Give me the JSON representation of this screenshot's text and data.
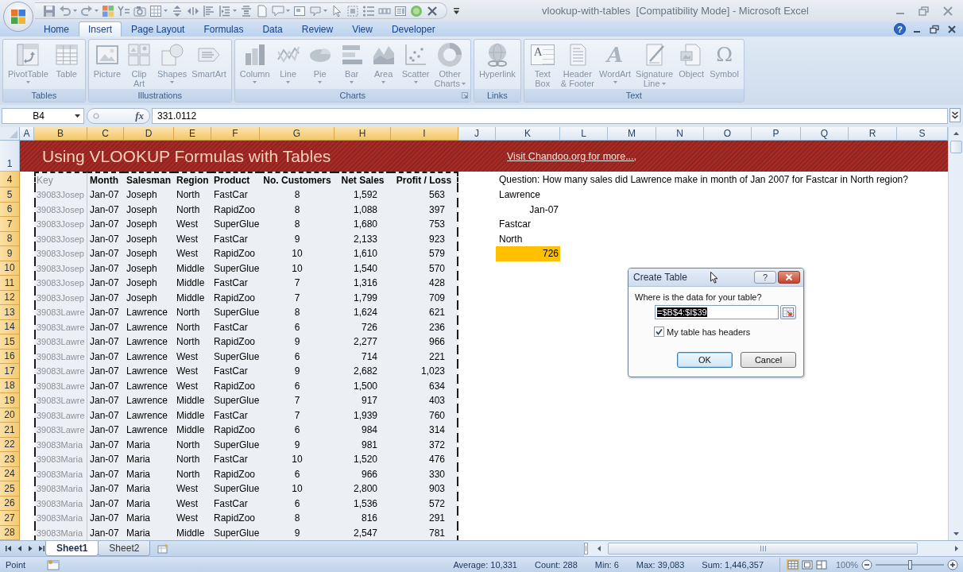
{
  "window": {
    "title": "vlookup-with-tables  [Compatibility Mode] - Microsoft Excel"
  },
  "ribbon_tabs": [
    {
      "label": "Home",
      "selected": false
    },
    {
      "label": "Insert",
      "selected": true
    },
    {
      "label": "Page Layout",
      "selected": false
    },
    {
      "label": "Formulas",
      "selected": false
    },
    {
      "label": "Data",
      "selected": false
    },
    {
      "label": "Review",
      "selected": false
    },
    {
      "label": "View",
      "selected": false
    },
    {
      "label": "Developer",
      "selected": false
    }
  ],
  "help_button": "?",
  "ribbon_groups": [
    {
      "label": "Tables",
      "launcher": false,
      "buttons": [
        {
          "label": "PivotTable",
          "dropdown": true,
          "disabled": true
        },
        {
          "label": "Table",
          "dropdown": false,
          "disabled": true
        }
      ]
    },
    {
      "label": "Illustrations",
      "launcher": false,
      "buttons": [
        {
          "label": "Picture",
          "dropdown": false,
          "disabled": true
        },
        {
          "label": "Clip\nArt",
          "dropdown": false,
          "disabled": true
        },
        {
          "label": "Shapes",
          "dropdown": true,
          "disabled": true
        },
        {
          "label": "SmartArt",
          "dropdown": false,
          "disabled": true
        }
      ]
    },
    {
      "label": "Charts",
      "launcher": true,
      "buttons": [
        {
          "label": "Column",
          "dropdown": true,
          "disabled": true
        },
        {
          "label": "Line",
          "dropdown": true,
          "disabled": true
        },
        {
          "label": "Pie",
          "dropdown": true,
          "disabled": true
        },
        {
          "label": "Bar",
          "dropdown": true,
          "disabled": true
        },
        {
          "label": "Area",
          "dropdown": true,
          "disabled": true
        },
        {
          "label": "Scatter",
          "dropdown": true,
          "disabled": true
        },
        {
          "label": "Other\nCharts",
          "dropdown": true,
          "disabled": true
        }
      ]
    },
    {
      "label": "Links",
      "launcher": false,
      "buttons": [
        {
          "label": "Hyperlink",
          "dropdown": false,
          "disabled": true
        }
      ]
    },
    {
      "label": "Text",
      "launcher": false,
      "buttons": [
        {
          "label": "Text\nBox",
          "glyph": "A",
          "dropdown": false,
          "disabled": true
        },
        {
          "label": "Header\n& Footer",
          "dropdown": false,
          "disabled": true
        },
        {
          "label": "WordArt",
          "glyph": "A",
          "dropdown": true,
          "disabled": true
        },
        {
          "label": "Signature\nLine",
          "dropdown": true,
          "disabled": true
        },
        {
          "label": "Object",
          "dropdown": false,
          "disabled": true
        },
        {
          "label": "Symbol",
          "glyph": "Ω",
          "dropdown": false,
          "disabled": true
        }
      ]
    }
  ],
  "formula_bar": {
    "name_box": "B4",
    "fx_label": "fx",
    "formula": "331.0112"
  },
  "columns": [
    {
      "label": "A",
      "selected": false
    },
    {
      "label": "B",
      "selected": true
    },
    {
      "label": "C",
      "selected": true
    },
    {
      "label": "D",
      "selected": true
    },
    {
      "label": "E",
      "selected": true
    },
    {
      "label": "F",
      "selected": true
    },
    {
      "label": "G",
      "selected": true
    },
    {
      "label": "H",
      "selected": true
    },
    {
      "label": "I",
      "selected": true
    },
    {
      "label": "J",
      "selected": false
    },
    {
      "label": "K",
      "selected": false
    },
    {
      "label": "L",
      "selected": false
    },
    {
      "label": "M",
      "selected": false
    },
    {
      "label": "N",
      "selected": false
    },
    {
      "label": "O",
      "selected": false
    },
    {
      "label": "P",
      "selected": false
    },
    {
      "label": "Q",
      "selected": false
    },
    {
      "label": "R",
      "selected": false
    },
    {
      "label": "S",
      "selected": false
    }
  ],
  "banner": {
    "row": "1",
    "selected": false,
    "title": "Using VLOOKUP Formulas with Tables",
    "link": "Visit Chandoo.org for more...,"
  },
  "header_row": {
    "row": "4",
    "selected": true,
    "cells": [
      "Key",
      "Month",
      "Salesman",
      "Region",
      "Product",
      "No. Customers",
      "Net Sales",
      "Profit / Loss"
    ],
    "side_cell": {
      "text": "Question: How many sales did Lawrence make in month of Jan 2007 for Fastcar in North region?",
      "kind": "text"
    }
  },
  "rows": [
    {
      "row": "5",
      "selected": true,
      "cells": [
        "39083Josep",
        "Jan-07",
        "Joseph",
        "North",
        "FastCar",
        "8",
        "1,592",
        "563"
      ],
      "side_cell": {
        "text": "Lawrence",
        "kind": "text"
      }
    },
    {
      "row": "6",
      "selected": true,
      "cells": [
        "39083Josep",
        "Jan-07",
        "Joseph",
        "North",
        "RapidZoo",
        "8",
        "1,088",
        "397"
      ],
      "side_cell": {
        "text": "Jan-07",
        "kind": "date"
      }
    },
    {
      "row": "7",
      "selected": true,
      "cells": [
        "39083Josep",
        "Jan-07",
        "Joseph",
        "West",
        "SuperGlue",
        "8",
        "1,680",
        "753"
      ],
      "side_cell": {
        "text": "Fastcar",
        "kind": "text"
      }
    },
    {
      "row": "8",
      "selected": true,
      "cells": [
        "39083Josep",
        "Jan-07",
        "Joseph",
        "West",
        "FastCar",
        "9",
        "2,133",
        "923"
      ],
      "side_cell": {
        "text": "North",
        "kind": "text"
      }
    },
    {
      "row": "9",
      "selected": true,
      "cells": [
        "39083Josep",
        "Jan-07",
        "Joseph",
        "West",
        "RapidZoo",
        "10",
        "1,610",
        "579"
      ],
      "side_cell": {
        "text": "726",
        "kind": "number",
        "color": "#ffc000"
      }
    },
    {
      "row": "10",
      "selected": true,
      "cells": [
        "39083Josep",
        "Jan-07",
        "Joseph",
        "Middle",
        "SuperGlue",
        "10",
        "1,540",
        "570"
      ]
    },
    {
      "row": "11",
      "selected": true,
      "cells": [
        "39083Josep",
        "Jan-07",
        "Joseph",
        "Middle",
        "FastCar",
        "7",
        "1,316",
        "428"
      ]
    },
    {
      "row": "12",
      "selected": true,
      "cells": [
        "39083Josep",
        "Jan-07",
        "Joseph",
        "Middle",
        "RapidZoo",
        "7",
        "1,799",
        "709"
      ]
    },
    {
      "row": "13",
      "selected": true,
      "cells": [
        "39083Lawre",
        "Jan-07",
        "Lawrence",
        "North",
        "SuperGlue",
        "8",
        "1,624",
        "621"
      ]
    },
    {
      "row": "14",
      "selected": true,
      "cells": [
        "39083Lawre",
        "Jan-07",
        "Lawrence",
        "North",
        "FastCar",
        "6",
        "726",
        "236"
      ]
    },
    {
      "row": "15",
      "selected": true,
      "cells": [
        "39083Lawre",
        "Jan-07",
        "Lawrence",
        "North",
        "RapidZoo",
        "9",
        "2,277",
        "966"
      ]
    },
    {
      "row": "16",
      "selected": true,
      "cells": [
        "39083Lawre",
        "Jan-07",
        "Lawrence",
        "West",
        "SuperGlue",
        "6",
        "714",
        "221"
      ]
    },
    {
      "row": "17",
      "selected": true,
      "cells": [
        "39083Lawre",
        "Jan-07",
        "Lawrence",
        "West",
        "FastCar",
        "9",
        "2,682",
        "1,023"
      ]
    },
    {
      "row": "18",
      "selected": true,
      "cells": [
        "39083Lawre",
        "Jan-07",
        "Lawrence",
        "West",
        "RapidZoo",
        "6",
        "1,500",
        "634"
      ]
    },
    {
      "row": "19",
      "selected": true,
      "cells": [
        "39083Lawre",
        "Jan-07",
        "Lawrence",
        "Middle",
        "SuperGlue",
        "7",
        "917",
        "403"
      ]
    },
    {
      "row": "20",
      "selected": true,
      "cells": [
        "39083Lawre",
        "Jan-07",
        "Lawrence",
        "Middle",
        "FastCar",
        "7",
        "1,939",
        "760"
      ]
    },
    {
      "row": "21",
      "selected": true,
      "cells": [
        "39083Lawre",
        "Jan-07",
        "Lawrence",
        "Middle",
        "RapidZoo",
        "6",
        "984",
        "314"
      ]
    },
    {
      "row": "22",
      "selected": true,
      "cells": [
        "39083Maria",
        "Jan-07",
        "Maria",
        "North",
        "SuperGlue",
        "9",
        "981",
        "372"
      ]
    },
    {
      "row": "23",
      "selected": true,
      "cells": [
        "39083Maria",
        "Jan-07",
        "Maria",
        "North",
        "FastCar",
        "10",
        "1,520",
        "476"
      ]
    },
    {
      "row": "24",
      "selected": true,
      "cells": [
        "39083Maria",
        "Jan-07",
        "Maria",
        "North",
        "RapidZoo",
        "6",
        "966",
        "330"
      ]
    },
    {
      "row": "25",
      "selected": true,
      "cells": [
        "39083Maria",
        "Jan-07",
        "Maria",
        "West",
        "SuperGlue",
        "10",
        "2,800",
        "903"
      ]
    },
    {
      "row": "26",
      "selected": true,
      "cells": [
        "39083Maria",
        "Jan-07",
        "Maria",
        "West",
        "FastCar",
        "6",
        "1,536",
        "572"
      ]
    },
    {
      "row": "27",
      "selected": true,
      "cells": [
        "39083Maria",
        "Jan-07",
        "Maria",
        "West",
        "RapidZoo",
        "8",
        "816",
        "291"
      ]
    },
    {
      "row": "28",
      "selected": true,
      "cells": [
        "39083Maria",
        "Jan-07",
        "Maria",
        "Middle",
        "SuperGlue",
        "9",
        "2,547",
        "781"
      ]
    }
  ],
  "sheet_tabs": [
    {
      "label": "Sheet1",
      "selected": true
    },
    {
      "label": "Sheet2",
      "selected": false
    }
  ],
  "dialog": {
    "title": "Create Table",
    "help": "?",
    "prompt": "Where is the data for your table?",
    "range": {
      "value": "=$B$4:$I$39",
      "selected": true
    },
    "checkbox": {
      "label": "My table has headers",
      "checked": true
    },
    "buttons": [
      {
        "label": "OK",
        "default": true
      },
      {
        "label": "Cancel",
        "default": false
      }
    ]
  },
  "status_bar": {
    "mode": "Point",
    "stats": [
      "Average: 10,331",
      "Count: 288",
      "Min: 6",
      "Max: 39,083",
      "Sum: 1,446,357"
    ],
    "view_buttons": [
      {
        "selected": true
      },
      {
        "selected": false
      },
      {
        "selected": false
      }
    ],
    "zoom": {
      "label": "100%",
      "disabled": true,
      "level": 0.5
    }
  }
}
